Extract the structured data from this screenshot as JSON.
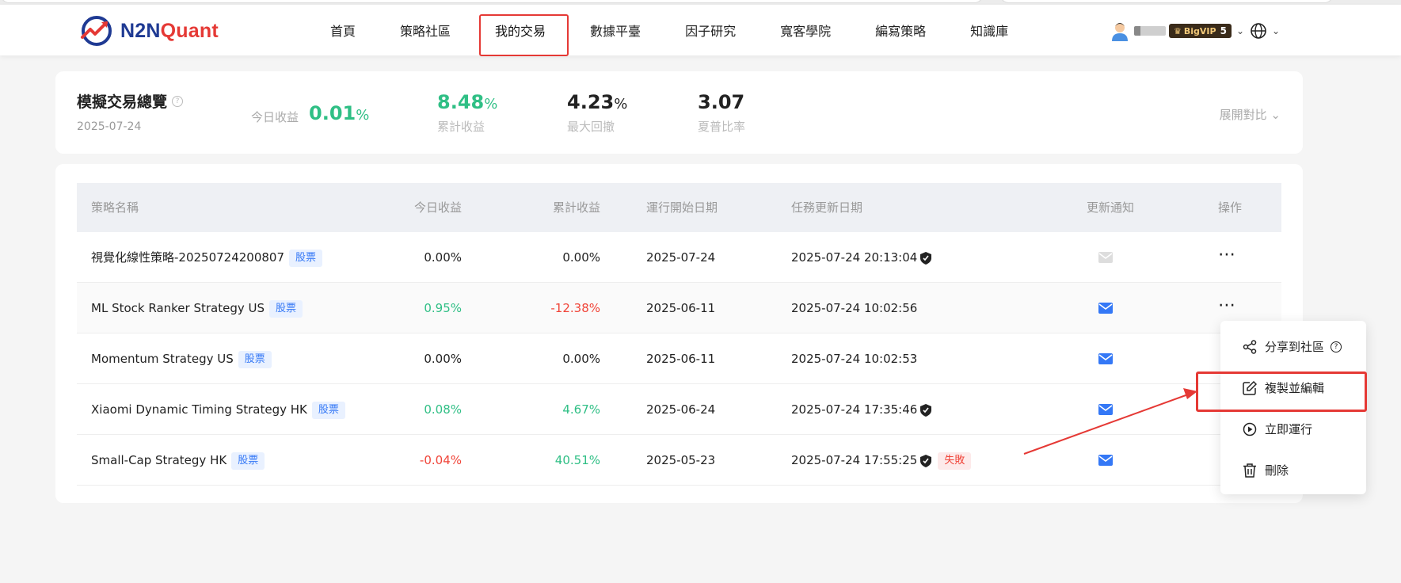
{
  "brand": {
    "name_prefix": "N2N",
    "name_suffix": "Quant"
  },
  "nav": {
    "items": [
      "首頁",
      "策略社區",
      "我的交易",
      "數據平臺",
      "因子研究",
      "寬客學院",
      "編寫策略",
      "知識庫"
    ],
    "active_index": 2,
    "vip_label": "BigVIP",
    "vip_level": "5"
  },
  "summary": {
    "title": "模擬交易總覽",
    "date": "2025-07-24",
    "today_label": "今日收益",
    "today_value": "0.01",
    "today_unit": "%",
    "metrics": [
      {
        "value": "8.48",
        "unit": "%",
        "label": "累計收益"
      },
      {
        "value": "4.23",
        "unit": "%",
        "label": "最大回撤"
      },
      {
        "value": "3.07",
        "unit": "",
        "label": "夏普比率"
      }
    ],
    "expand_label": "展開對比"
  },
  "table": {
    "headers": [
      "策略名稱",
      "今日收益",
      "累計收益",
      "運行開始日期",
      "任務更新日期",
      "更新通知",
      "操作"
    ],
    "tag_label": "股票",
    "fail_label": "失敗",
    "rows": [
      {
        "name": "視覺化線性策略-20250724200807",
        "today": "0.00%",
        "total": "0.00%",
        "start": "2025-07-24",
        "updated": "2025-07-24 20:13:04"
      },
      {
        "name": "ML Stock Ranker Strategy US",
        "today": "0.95%",
        "total": "-12.38%",
        "start": "2025-06-11",
        "updated": "2025-07-24 10:02:56"
      },
      {
        "name": "Momentum Strategy US",
        "today": "0.00%",
        "total": "0.00%",
        "start": "2025-06-11",
        "updated": "2025-07-24 10:02:53"
      },
      {
        "name": "Xiaomi Dynamic Timing Strategy HK",
        "today": "0.08%",
        "total": "4.67%",
        "start": "2025-06-24",
        "updated": "2025-07-24 17:35:46"
      },
      {
        "name": "Small-Cap Strategy HK",
        "today": "-0.04%",
        "total": "40.51%",
        "start": "2025-05-23",
        "updated": "2025-07-24 17:55:25"
      }
    ]
  },
  "dropdown": {
    "items": [
      "分享到社區",
      "複製並編輯",
      "立即運行",
      "刪除"
    ]
  },
  "colors": {
    "green": "#2fbf85",
    "red": "#f04438",
    "blue": "#3478f6",
    "highlight": "#e53935"
  }
}
